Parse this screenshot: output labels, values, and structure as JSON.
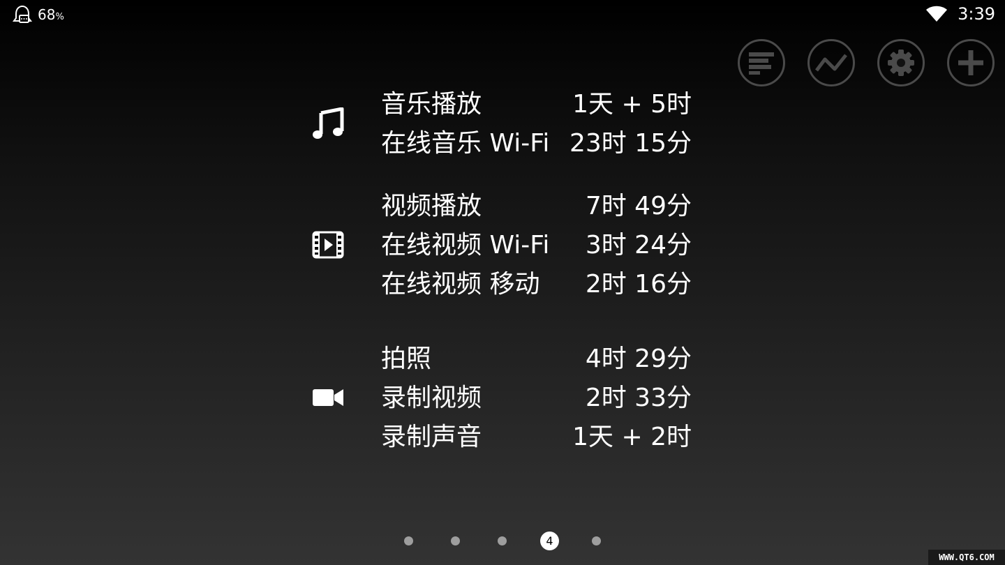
{
  "statusbar": {
    "battery_value": "68",
    "battery_unit": "%",
    "time": "3:39",
    "left_icon": "battery-app-icon",
    "wifi_icon": "wifi-icon"
  },
  "actions": [
    {
      "name": "list-view-button",
      "icon": "bar-list-icon"
    },
    {
      "name": "graph-view-button",
      "icon": "line-graph-icon"
    },
    {
      "name": "settings-button",
      "icon": "gear-icon"
    },
    {
      "name": "add-button",
      "icon": "plus-icon"
    }
  ],
  "groups": {
    "music": {
      "icon": "music-note-icon",
      "rows": [
        {
          "label": "音乐播放",
          "value": "1天 + 5时"
        },
        {
          "label": "在线音乐 Wi-Fi",
          "value": "23时 15分"
        }
      ]
    },
    "video": {
      "icon": "film-icon",
      "rows": [
        {
          "label": "视频播放",
          "value": "7时 49分"
        },
        {
          "label": "在线视频 Wi-Fi",
          "value": "3时 24分"
        },
        {
          "label": "在线视频 移动",
          "value": "2时 16分"
        }
      ]
    },
    "camera": {
      "icon": "video-camera-icon",
      "rows": [
        {
          "label": "拍照",
          "value": "4时 29分"
        },
        {
          "label": "录制视频",
          "value": "2时 33分"
        },
        {
          "label": "录制声音",
          "value": "1天 + 2时"
        }
      ]
    }
  },
  "pager": {
    "count": 5,
    "active_label": "4"
  },
  "watermark": "WWW.QT6.COM",
  "colors": {
    "button_border": "#4a4a4a",
    "dot_inactive": "#9e9e9e",
    "dot_active": "#ffffff"
  }
}
